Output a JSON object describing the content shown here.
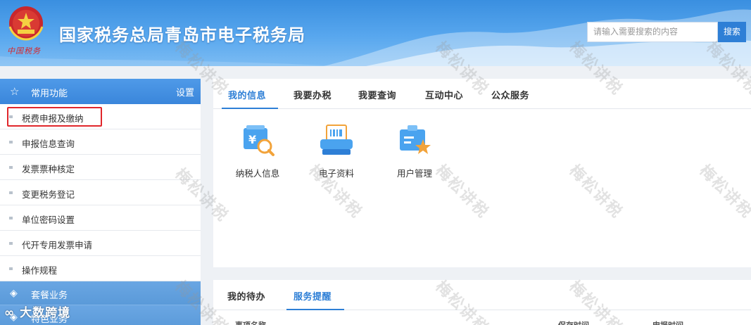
{
  "header": {
    "brand_sub": "中国税务",
    "site_title": "国家税务总局青岛市电子税务局",
    "search_placeholder": "请输入需要搜索的内容",
    "search_button": "搜索",
    "colors": {
      "header_blue": "#3a8fe0",
      "accent": "#2e7fd6",
      "highlight_red": "#e0262b"
    }
  },
  "sidebar": {
    "header_label": "常用功能",
    "settings_label": "设置",
    "items": [
      {
        "label": "税费申报及缴纳"
      },
      {
        "label": "申报信息查询"
      },
      {
        "label": "发票票种核定"
      },
      {
        "label": "变更税务登记"
      },
      {
        "label": "单位密码设置"
      },
      {
        "label": "代开专用发票申请"
      },
      {
        "label": "操作规程"
      }
    ],
    "groups": [
      {
        "label": "套餐业务"
      },
      {
        "label": "特色业务"
      }
    ]
  },
  "main": {
    "tabs": [
      {
        "label": "我的信息"
      },
      {
        "label": "我要办税"
      },
      {
        "label": "我要查询"
      },
      {
        "label": "互动中心"
      },
      {
        "label": "公众服务"
      }
    ],
    "tiles": [
      {
        "label": "纳税人信息",
        "icon": "taxpayer-info-icon"
      },
      {
        "label": "电子资料",
        "icon": "e-documents-icon"
      },
      {
        "label": "用户管理",
        "icon": "user-management-icon"
      }
    ],
    "lower_tabs": [
      {
        "label": "我的待办"
      },
      {
        "label": "服务提醒"
      }
    ],
    "lower_columns": [
      "事项名称",
      "保存时间",
      "申报时间"
    ]
  },
  "overlay": {
    "corner_brand": "大数跨境",
    "watermark": "梅松讲税"
  }
}
